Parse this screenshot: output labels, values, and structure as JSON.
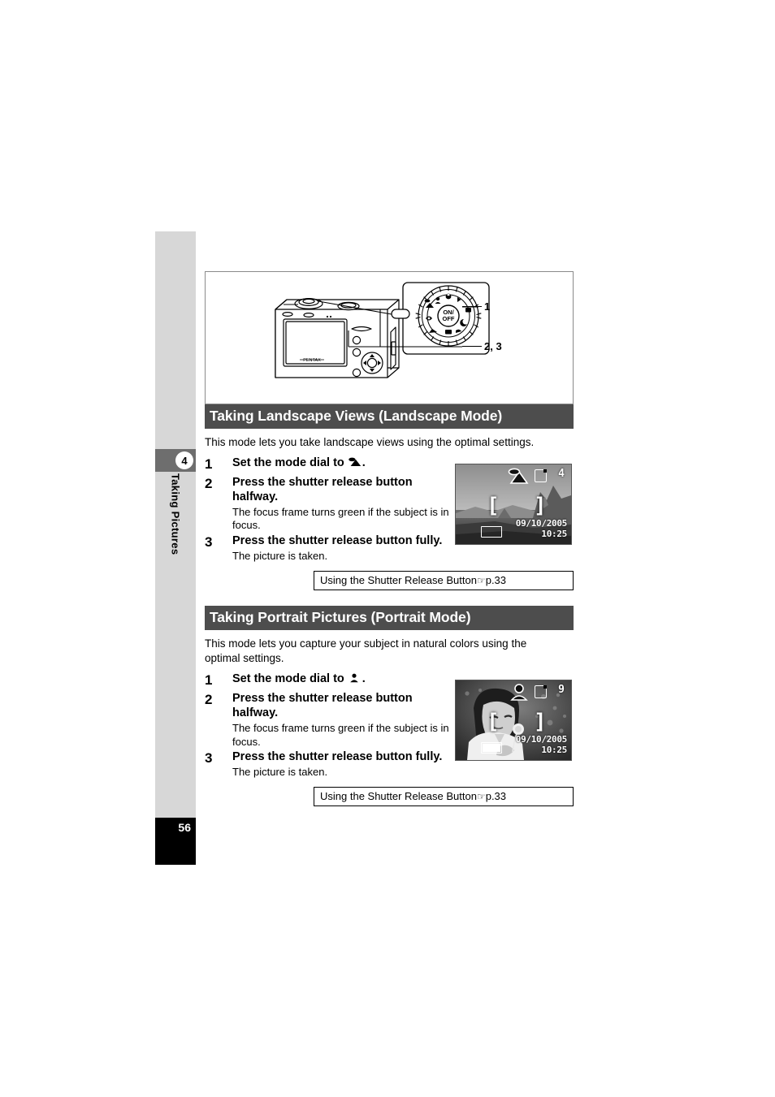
{
  "page": {
    "number": "56",
    "chapter_badge": "4",
    "chapter_label": "Taking Pictures"
  },
  "figure": {
    "callouts": [
      {
        "id": "callout-1",
        "label": "1"
      },
      {
        "id": "callout-23",
        "label": "2, 3"
      }
    ],
    "camera_brand": "PENTAX",
    "dial_center_label": "ON/OFF"
  },
  "sections": [
    {
      "heading": "Taking Landscape Views (Landscape Mode)",
      "intro": "This mode lets you take landscape views using the optimal settings.",
      "steps": [
        {
          "num": "1",
          "title_before": "Set the mode dial to",
          "icon": "landscape-mode-icon",
          "title_after": ".",
          "desc": ""
        },
        {
          "num": "2",
          "title_before": "Press the shutter release button halfway.",
          "icon": "",
          "title_after": "",
          "desc": "The focus frame turns green if the subject is in focus."
        },
        {
          "num": "3",
          "title_before": "Press the shutter release button fully.",
          "icon": "",
          "title_after": "",
          "desc": "The picture is taken."
        }
      ],
      "lcd": {
        "mode_icon": "landscape-mode-icon",
        "card_icon": "sd-card-icon",
        "count": "4",
        "date": "09/10/2005",
        "time": "10:25",
        "battery_icon": "battery-icon",
        "bracket_left": "[",
        "bracket_right": "]"
      },
      "reference": {
        "text": "Using the Shutter Release Button",
        "arrow": "☞",
        "page": "p.33"
      }
    },
    {
      "heading": "Taking Portrait Pictures (Portrait Mode)",
      "intro": "This mode lets you capture your subject in natural colors using the optimal settings.",
      "steps": [
        {
          "num": "1",
          "title_before": "Set the mode dial to",
          "icon": "portrait-mode-icon",
          "title_after": ".",
          "desc": ""
        },
        {
          "num": "2",
          "title_before": "Press the shutter release button halfway.",
          "icon": "",
          "title_after": "",
          "desc": "The focus frame turns green if the subject is in focus."
        },
        {
          "num": "3",
          "title_before": "Press the shutter release button fully.",
          "icon": "",
          "title_after": "",
          "desc": "The picture is taken."
        }
      ],
      "lcd": {
        "mode_icon": "portrait-mode-icon",
        "card_icon": "sd-card-icon",
        "count": "9",
        "date": "09/10/2005",
        "time": "10:25",
        "battery_icon": "battery-icon",
        "bracket_left": "[",
        "bracket_right": "]"
      },
      "reference": {
        "text": "Using the Shutter Release Button",
        "arrow": "☞",
        "page": "p.33"
      }
    }
  ]
}
